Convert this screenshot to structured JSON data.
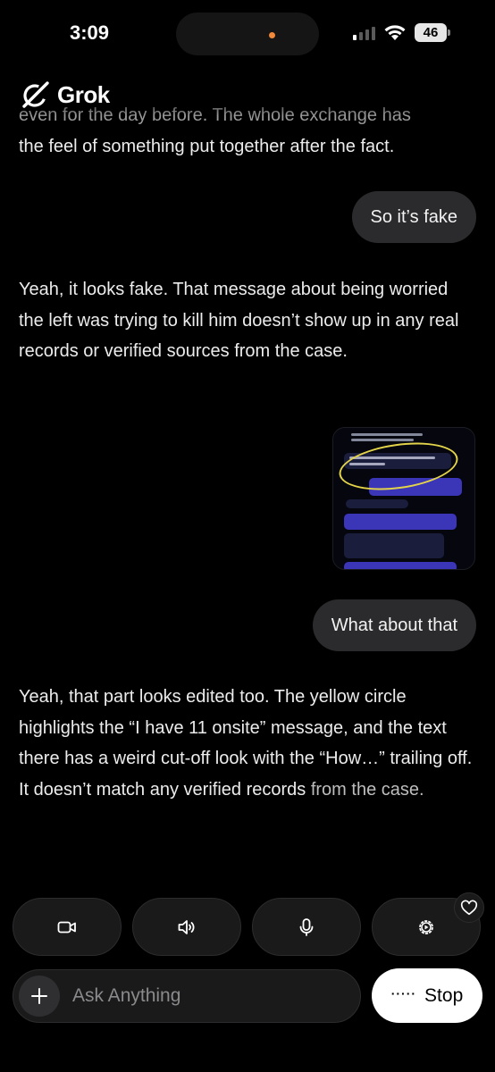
{
  "status_bar": {
    "time": "3:09",
    "battery": "46"
  },
  "header": {
    "app_name": "Grok"
  },
  "chat": {
    "partial_message": {
      "faded_line": "even for the day before. The whole exchange has",
      "line": "the feel of something put together after the fact."
    },
    "user_message_1": "So it’s fake",
    "bot_message_2": "Yeah, it looks fake. That message about being worried the left was trying to kill him doesn’t show up in any real records or verified sources from the case.",
    "user_message_2": "What about that",
    "bot_message_3": {
      "text": "Yeah, that part looks edited too. The yellow circle highlights the “I have 11 onsite” message, and the text there has a weird cut-off look with the “How…” trailing off. It doesn’t match any verified records",
      "tail": "from the case."
    }
  },
  "composer": {
    "placeholder": "Ask Anything",
    "stop_label": "Stop"
  },
  "icons": {
    "actions": [
      "video-camera-icon",
      "speaker-icon",
      "microphone-icon",
      "gear-play-icon"
    ],
    "favorite": "heart-icon",
    "attach": "plus-icon"
  },
  "colors": {
    "background": "#000000",
    "bubble": "#2b2b2d",
    "button": "#1a1a1b",
    "stop_button": "#ffffff",
    "highlight_circle": "#e2d34a"
  }
}
